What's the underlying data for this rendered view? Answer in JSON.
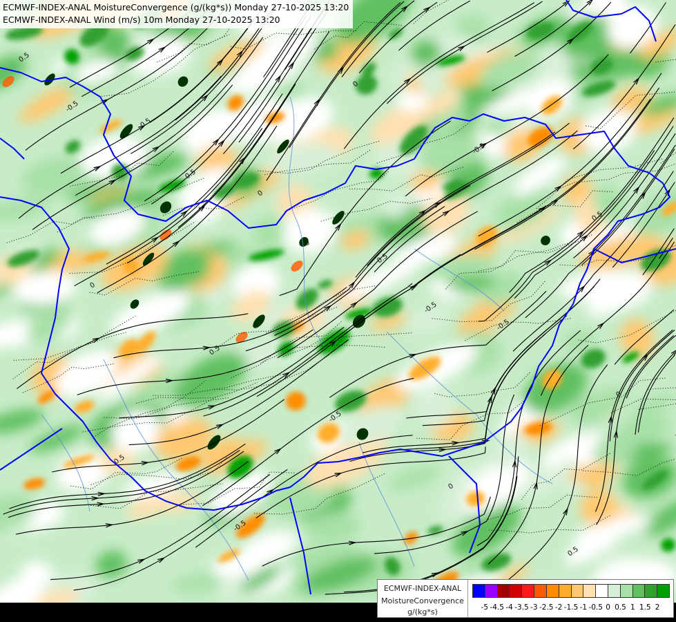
{
  "title": {
    "line1": "ECMWF-INDEX-ANAL MoistureConvergence (g/(kg*s)) Monday 27-10-2025 13:20",
    "line2": "ECMWF-INDEX-ANAL Wind (m/s) 10m Monday 27-10-2025 13:20"
  },
  "legend": {
    "line1": "ECMWF-INDEX-ANAL",
    "line2": "MoistureConvergence",
    "line3": "g/(kg*s)",
    "colors": [
      "#0000ff",
      "#9b00ff",
      "#a00000",
      "#d00000",
      "#ff1a1a",
      "#ff5a00",
      "#ff8c00",
      "#ffad2a",
      "#ffc870",
      "#ffe0b0",
      "#ffffff",
      "#d8f0d8",
      "#a8e0a8",
      "#60c060",
      "#30a030",
      "#00a000"
    ],
    "ticks": [
      "-5",
      "-4.5",
      "-4",
      "-3.5",
      "-3",
      "-2.5",
      "-2",
      "-1.5",
      "-1",
      "-0.5",
      "0",
      "0.5",
      "1",
      "1.5",
      "2"
    ]
  },
  "contour_labels": [
    "0.5",
    "-0.5",
    "0",
    "0.5",
    "-0.5",
    "0",
    "0.5",
    "-0.5",
    "0",
    "-0.5",
    "0.5",
    "0",
    "0.5",
    "-0.5",
    "0",
    "0.5",
    "-0.5",
    "0.5",
    "0",
    "-0.5"
  ],
  "map_style": {
    "border_color": "#0000ff",
    "streamline_color": "#000000",
    "contour_style": "dotted"
  }
}
